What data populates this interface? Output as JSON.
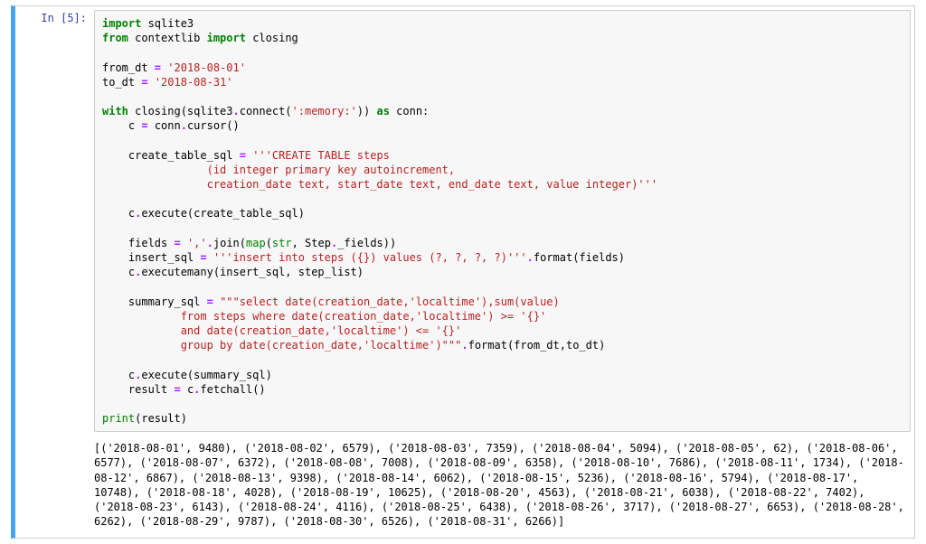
{
  "cell": {
    "prompt": "In [5]:",
    "code_lines": [
      [
        [
          "kw",
          "import"
        ],
        [
          "nm",
          " sqlite3"
        ]
      ],
      [
        [
          "kw",
          "from"
        ],
        [
          "nm",
          " contextlib "
        ],
        [
          "kw",
          "import"
        ],
        [
          "nm",
          " closing"
        ]
      ],
      [],
      [
        [
          "nm",
          "from_dt "
        ],
        [
          "op",
          "="
        ],
        [
          "nm",
          " "
        ],
        [
          "str",
          "'2018-08-01'"
        ]
      ],
      [
        [
          "nm",
          "to_dt "
        ],
        [
          "op",
          "="
        ],
        [
          "nm",
          " "
        ],
        [
          "str",
          "'2018-08-31'"
        ]
      ],
      [],
      [
        [
          "kw",
          "with"
        ],
        [
          "nm",
          " closing(sqlite3"
        ],
        [
          "op",
          "."
        ],
        [
          "nm",
          "connect("
        ],
        [
          "str",
          "':memory:'"
        ],
        [
          "nm",
          ")) "
        ],
        [
          "kw",
          "as"
        ],
        [
          "nm",
          " conn:"
        ]
      ],
      [
        [
          "nm",
          "    c "
        ],
        [
          "op",
          "="
        ],
        [
          "nm",
          " conn"
        ],
        [
          "op",
          "."
        ],
        [
          "nm",
          "cursor()"
        ]
      ],
      [],
      [
        [
          "nm",
          "    create_table_sql "
        ],
        [
          "op",
          "="
        ],
        [
          "nm",
          " "
        ],
        [
          "str",
          "'''CREATE TABLE steps"
        ]
      ],
      [
        [
          "str",
          "                (id integer primary key autoincrement,"
        ]
      ],
      [
        [
          "str",
          "                creation_date text, start_date text, end_date text, value integer)'''"
        ]
      ],
      [],
      [
        [
          "nm",
          "    c"
        ],
        [
          "op",
          "."
        ],
        [
          "nm",
          "execute(create_table_sql)"
        ]
      ],
      [],
      [
        [
          "nm",
          "    fields "
        ],
        [
          "op",
          "="
        ],
        [
          "nm",
          " "
        ],
        [
          "str",
          "','"
        ],
        [
          "op",
          "."
        ],
        [
          "nm",
          "join("
        ],
        [
          "bn",
          "map"
        ],
        [
          "nm",
          "("
        ],
        [
          "bn",
          "str"
        ],
        [
          "nm",
          ", Step"
        ],
        [
          "op",
          "."
        ],
        [
          "nm",
          "_fields))"
        ]
      ],
      [
        [
          "nm",
          "    insert_sql "
        ],
        [
          "op",
          "="
        ],
        [
          "nm",
          " "
        ],
        [
          "str",
          "'''insert into steps ({}) values (?, ?, ?, ?)'''"
        ],
        [
          "op",
          "."
        ],
        [
          "nm",
          "format(fields)"
        ]
      ],
      [
        [
          "nm",
          "    c"
        ],
        [
          "op",
          "."
        ],
        [
          "nm",
          "executemany(insert_sql, step_list)"
        ]
      ],
      [],
      [
        [
          "nm",
          "    summary_sql "
        ],
        [
          "op",
          "="
        ],
        [
          "nm",
          " "
        ],
        [
          "str",
          "\"\"\"select date(creation_date,'localtime'),sum(value)"
        ]
      ],
      [
        [
          "str",
          "            from steps where date(creation_date,'localtime') >= '{}'"
        ]
      ],
      [
        [
          "str",
          "            and date(creation_date,'localtime') <= '{}'"
        ]
      ],
      [
        [
          "str",
          "            group by date(creation_date,'localtime')\"\"\""
        ],
        [
          "op",
          "."
        ],
        [
          "nm",
          "format(from_dt,to_dt)"
        ]
      ],
      [],
      [
        [
          "nm",
          "    c"
        ],
        [
          "op",
          "."
        ],
        [
          "nm",
          "execute(summary_sql)"
        ]
      ],
      [
        [
          "nm",
          "    result "
        ],
        [
          "op",
          "="
        ],
        [
          "nm",
          " c"
        ],
        [
          "op",
          "."
        ],
        [
          "nm",
          "fetchall()"
        ]
      ],
      [],
      [
        [
          "bn",
          "print"
        ],
        [
          "nm",
          "(result)"
        ]
      ]
    ],
    "output": "[('2018-08-01', 9480), ('2018-08-02', 6579), ('2018-08-03', 7359), ('2018-08-04', 5094), ('2018-08-05', 62), ('2018-08-06', 6577), ('2018-08-07', 6372), ('2018-08-08', 7008), ('2018-08-09', 6358), ('2018-08-10', 7686), ('2018-08-11', 1734), ('2018-08-12', 6867), ('2018-08-13', 9398), ('2018-08-14', 6062), ('2018-08-15', 5236), ('2018-08-16', 5794), ('2018-08-17', 10748), ('2018-08-18', 4028), ('2018-08-19', 10625), ('2018-08-20', 4563), ('2018-08-21', 6038), ('2018-08-22', 7402), ('2018-08-23', 6143), ('2018-08-24', 4116), ('2018-08-25', 6438), ('2018-08-26', 3717), ('2018-08-27', 6653), ('2018-08-28', 6262), ('2018-08-29', 9787), ('2018-08-30', 6526), ('2018-08-31', 6266)]"
  }
}
